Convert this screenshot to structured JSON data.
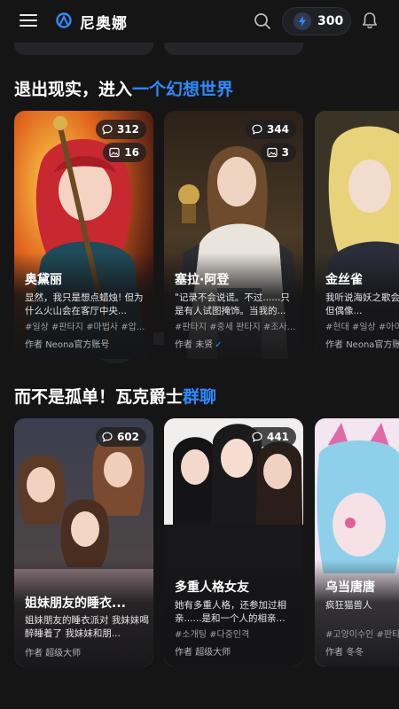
{
  "app": {
    "title": "尼奥娜",
    "credits": "300"
  },
  "sections": [
    {
      "title_prefix": "退出现实，进入",
      "title_highlight": "一个幻想世界",
      "cards": [
        {
          "name": "奥黛丽",
          "desc": "显然，我只是想点蜡烛! 但为什么火山会在客厅中央...",
          "tags": "#일상 #판타지 #마법사 #압...",
          "author_prefix": "作者",
          "author": "Neona官方账号",
          "verified": false,
          "chats": "312",
          "images": "16"
        },
        {
          "name": "塞拉·阿登",
          "desc": "\"记录不会说谎。不过......只是有人试图掩饰。当我的...",
          "tags": "#판타지 #중세 판타지 #조사...",
          "author_prefix": "作者",
          "author": "未贤",
          "verified": true,
          "chats": "344",
          "images": "3"
        },
        {
          "name": "金丝雀",
          "desc": "我听说海妖之歌会带来死亡。但偶像...",
          "tags": "#현대 #일상 #아이돌",
          "author_prefix": "作者",
          "author": "Neona官方账号",
          "verified": false,
          "chats": "",
          "images": ""
        }
      ]
    },
    {
      "title_prefix": "而不是孤单！瓦克爵士",
      "title_highlight": "群聊",
      "cards": [
        {
          "name": "姐妹朋友的睡衣...",
          "desc": "姐妹朋友的睡衣派对 我妹妹喝醉睡着了 我妹妹和朋...",
          "tags": "",
          "author_prefix": "作者",
          "author": "超级大师",
          "verified": false,
          "chats": "602",
          "images": ""
        },
        {
          "name": "多重人格女友",
          "desc": "她有多重人格，还参加过相亲......是和一个人的相亲...",
          "tags": "#소개팅 #다중인격",
          "author_prefix": "作者",
          "author": "超级大师",
          "verified": false,
          "chats": "441",
          "images": ""
        },
        {
          "name": "乌当唐唐",
          "desc": "疯狂猫兽人",
          "tags": "#고양이수인 #판타지",
          "author_prefix": "作者",
          "author": "冬冬",
          "verified": false,
          "chats": "",
          "images": ""
        }
      ]
    }
  ],
  "colors": {
    "background": "#151516",
    "accent": "#2e8bff",
    "card_background": "#222222",
    "tag_text": "#9c9ca2"
  },
  "icons": {
    "menu": "menu-icon",
    "logo": "neona-logo-icon",
    "search": "search-icon",
    "credit": "lightning-bolt-icon",
    "notifications": "bell-icon",
    "chat_count": "chat-bubble-icon",
    "image_count": "image-icon"
  }
}
